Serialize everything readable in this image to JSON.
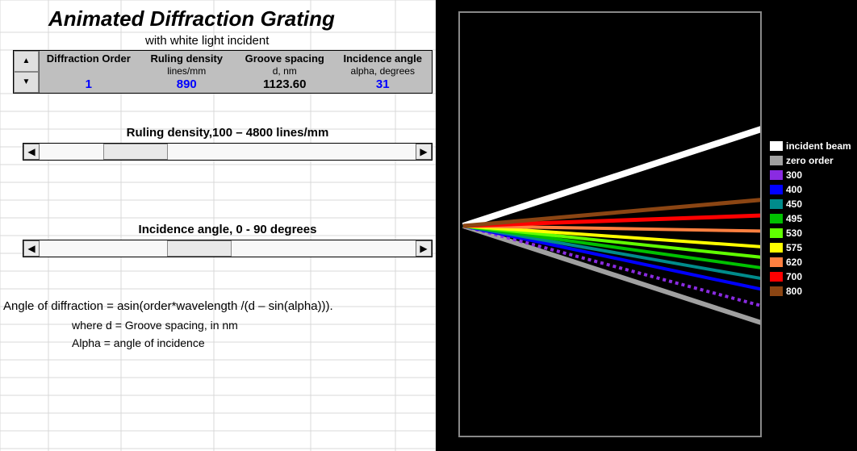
{
  "title": "Animated Diffraction Grating",
  "subtitle": "with white light incident",
  "params": {
    "order": {
      "head": "Diffraction Order",
      "sub": "",
      "val": "1"
    },
    "ruling": {
      "head": "Ruling density",
      "sub": "lines/mm",
      "val": "890"
    },
    "spacing": {
      "head": "Groove spacing",
      "sub": "d, nm",
      "val": "1123.60"
    },
    "alpha": {
      "head": "Incidence angle",
      "sub": "alpha, degrees",
      "val": "31"
    }
  },
  "slider1": {
    "label": "Ruling density,100 – 4800 lines/mm",
    "thumb_pct": 17
  },
  "slider2": {
    "label": "Incidence angle, 0 - 90 degrees",
    "thumb_pct": 34
  },
  "formula": {
    "line1": "Angle of diffraction = asin(order*wavelength /(d – sin(alpha))).",
    "line2": "where d = Groove spacing, in nm",
    "line3": "Alpha = angle of incidence"
  },
  "chart_data": {
    "type": "line",
    "origin_y_pct": 50,
    "beams": [
      {
        "name": "incident beam",
        "angle_deg": -18,
        "color": "#ffffff",
        "width": 8
      },
      {
        "name": "zero order",
        "angle_deg": 18,
        "color": "#a0a0a0",
        "width": 6
      },
      {
        "name": "300",
        "angle_deg": 15,
        "color": "#8a2be2",
        "width": 4,
        "dashed": true
      },
      {
        "name": "400",
        "angle_deg": 12,
        "color": "#0000ff",
        "width": 4
      },
      {
        "name": "450",
        "angle_deg": 10,
        "color": "#008b8b",
        "width": 4
      },
      {
        "name": "495",
        "angle_deg": 8,
        "color": "#00c000",
        "width": 4
      },
      {
        "name": "530",
        "angle_deg": 6,
        "color": "#60ff00",
        "width": 4
      },
      {
        "name": "575",
        "angle_deg": 4,
        "color": "#ffff00",
        "width": 4
      },
      {
        "name": "620",
        "angle_deg": 1,
        "color": "#ff8040",
        "width": 4
      },
      {
        "name": "700",
        "angle_deg": -2,
        "color": "#ff0000",
        "width": 5
      },
      {
        "name": "800",
        "angle_deg": -5,
        "color": "#8b4513",
        "width": 5
      }
    ]
  },
  "legend": [
    {
      "label": "incident beam",
      "color": "#ffffff"
    },
    {
      "label": "zero order",
      "color": "#a0a0a0"
    },
    {
      "label": "300",
      "color": "#8a2be2"
    },
    {
      "label": "400",
      "color": "#0000ff"
    },
    {
      "label": "450",
      "color": "#008b8b"
    },
    {
      "label": "495",
      "color": "#00c000"
    },
    {
      "label": "530",
      "color": "#60ff00"
    },
    {
      "label": "575",
      "color": "#ffff00"
    },
    {
      "label": "620",
      "color": "#ff8040"
    },
    {
      "label": "700",
      "color": "#ff0000"
    },
    {
      "label": "800",
      "color": "#8b4513"
    }
  ]
}
